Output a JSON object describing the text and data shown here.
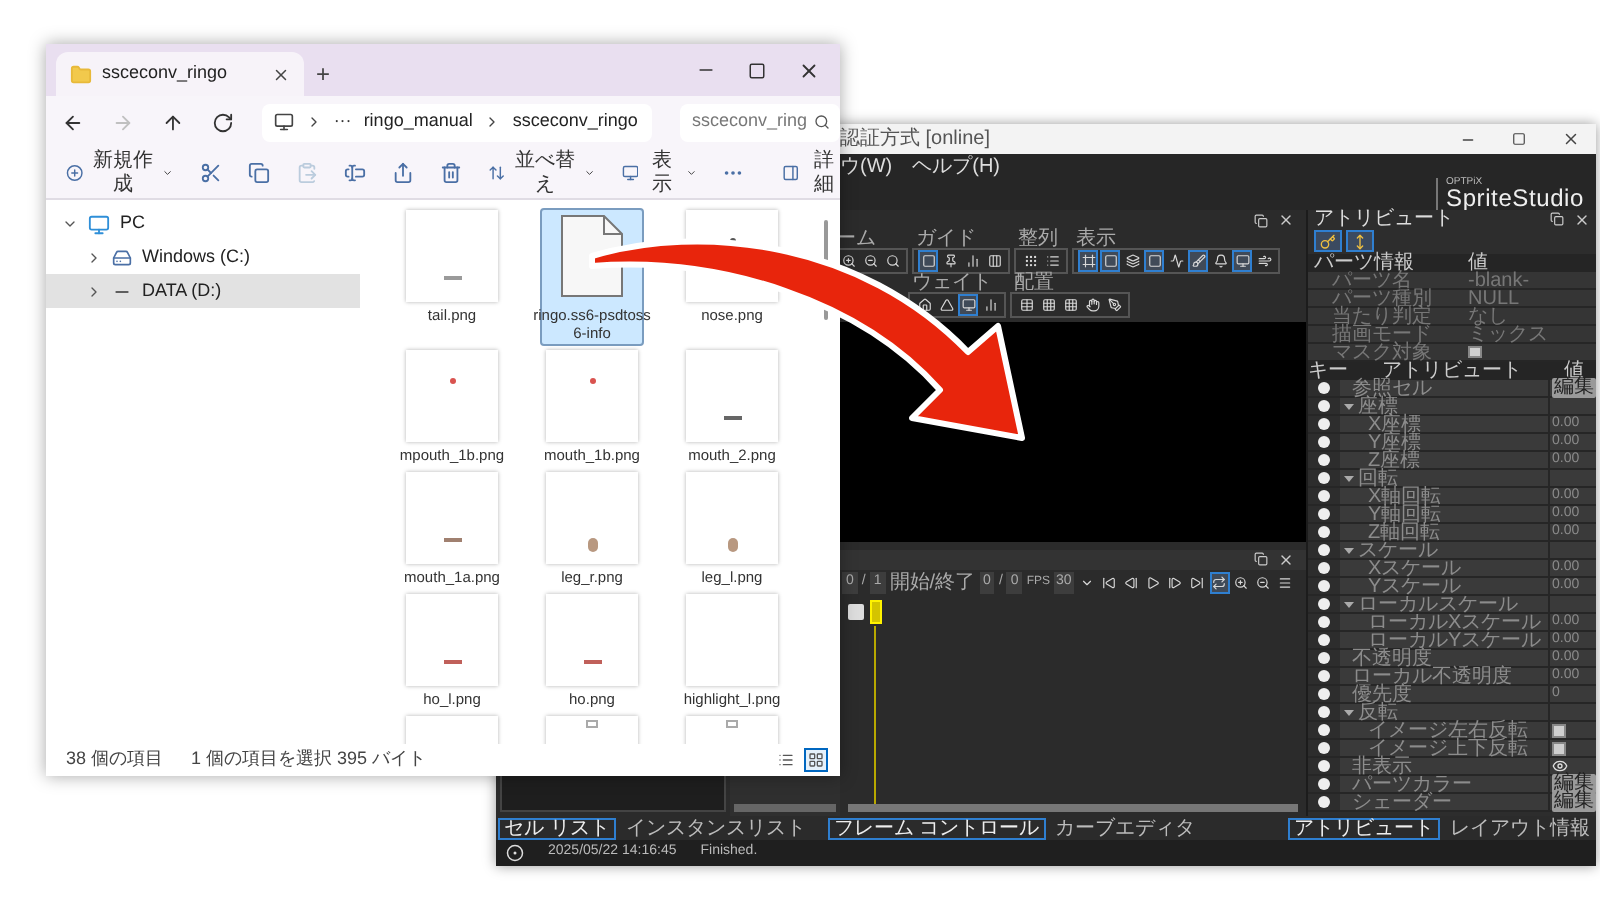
{
  "explorer": {
    "tab": {
      "title": "ssceconv_ringo",
      "add": "+"
    },
    "nav": [
      {
        "kind": "back",
        "disabled": false
      },
      {
        "kind": "forward",
        "disabled": true
      },
      {
        "kind": "up",
        "disabled": false
      },
      {
        "kind": "refresh",
        "disabled": false
      }
    ],
    "address": {
      "ellipsis": "···",
      "path": [
        "ringo_manual",
        "ssceconv_ringo"
      ]
    },
    "search": {
      "placeholder": "ssceconv_ring"
    },
    "toolbar": [
      {
        "kind": "new",
        "label": "新規作成",
        "disabled": false
      },
      {
        "kind": "cut",
        "disabled": false
      },
      {
        "kind": "copy",
        "disabled": false
      },
      {
        "kind": "paste",
        "disabled": true
      },
      {
        "kind": "rename",
        "disabled": false
      },
      {
        "kind": "share",
        "disabled": false
      },
      {
        "kind": "delete",
        "disabled": false
      },
      {
        "kind": "sort",
        "label": "並べ替え",
        "disabled": false
      },
      {
        "kind": "view",
        "label": "表示",
        "disabled": false
      },
      {
        "kind": "more",
        "disabled": false
      },
      {
        "kind": "details",
        "label": "詳細",
        "disabled": false
      }
    ],
    "sidebar": {
      "items": [
        {
          "kind": "pc",
          "label": "PC",
          "expanded": true,
          "selected": false,
          "children": [
            {
              "kind": "system",
              "label": "Windows (C:)",
              "expanded": false,
              "selected": false
            },
            {
              "kind": "drive",
              "label": "DATA (D:)",
              "expanded": false,
              "selected": true
            }
          ]
        }
      ]
    },
    "files": [
      {
        "name": "tail.png",
        "kind": "dash",
        "color": "#9a9a9a",
        "selected": false
      },
      {
        "name": "ringo.ss6-psdtoss6-info",
        "kind": "doc",
        "color": "#f7f7f7",
        "selected": true
      },
      {
        "name": "nose.png",
        "kind": "dot",
        "color": "#555555",
        "selected": false
      },
      {
        "name": "mpouth_1b.png",
        "kind": "dot",
        "color": "#d9534f",
        "selected": false
      },
      {
        "name": "mouth_1b.png",
        "kind": "dot",
        "color": "#d9534f",
        "selected": false
      },
      {
        "name": "mouth_2.png",
        "kind": "dash",
        "color": "#666666",
        "selected": false
      },
      {
        "name": "mouth_1a.png",
        "kind": "dash",
        "color": "#a08070",
        "selected": false
      },
      {
        "name": "leg_r.png",
        "kind": "oval",
        "color": "#b89880",
        "selected": false
      },
      {
        "name": "leg_l.png",
        "kind": "oval",
        "color": "#b89880",
        "selected": false
      },
      {
        "name": "ho_l.png",
        "kind": "dash",
        "color": "#c0605a",
        "selected": false
      },
      {
        "name": "ho.png",
        "kind": "dash",
        "color": "#c0605a",
        "selected": false
      },
      {
        "name": "highlight_l.png",
        "kind": "none",
        "selected": false
      },
      {
        "kind": "none",
        "selected": false
      },
      {
        "kind": "chip",
        "color": "#aaaaaa",
        "selected": false
      },
      {
        "kind": "chip",
        "color": "#aaaaaa",
        "selected": false
      }
    ],
    "status": [
      "38 個の項目",
      "1 個の項目を選択 395 バイト"
    ],
    "views": [
      {
        "kind": "details",
        "selected": false
      },
      {
        "kind": "tiles",
        "selected": true
      }
    ]
  },
  "sprite_studio": {
    "title": "認証方式 [online]",
    "menu": [
      "ウ(W)",
      "ヘルプ(H)"
    ],
    "logo": {
      "maker": "OPTPiX",
      "name": "SpriteStudio"
    },
    "toolbar_rows": [
      [
        {
          "label": "ーム",
          "tools": [
            {
              "kind": "zoomin",
              "selected": false
            },
            {
              "kind": "zoomout",
              "selected": false
            },
            {
              "kind": "zoomfit",
              "selected": false
            }
          ]
        },
        {
          "label": "ガイド",
          "tools": [
            {
              "kind": "square",
              "selected": true
            },
            {
              "kind": "pin",
              "selected": false
            },
            {
              "kind": "chart",
              "selected": false
            },
            {
              "kind": "columns",
              "selected": false
            }
          ]
        },
        {
          "label": "整列",
          "tools": [
            {
              "kind": "grip",
              "selected": false
            },
            {
              "kind": "list",
              "selected": false
            }
          ]
        },
        {
          "label": "表示",
          "tools": [
            {
              "kind": "frame",
              "selected": true
            },
            {
              "kind": "square",
              "selected": true
            },
            {
              "kind": "layers",
              "selected": false
            },
            {
              "kind": "square",
              "selected": true
            },
            {
              "kind": "activity",
              "selected": false
            },
            {
              "kind": "brush",
              "selected": true
            },
            {
              "kind": "bell",
              "selected": false
            },
            {
              "kind": "monitor",
              "selected": true
            },
            {
              "kind": "wind",
              "selected": false
            }
          ]
        }
      ],
      [
        {
          "label": "ウェイト",
          "tools": [
            {
              "kind": "house",
              "selected": false
            },
            {
              "kind": "triangle",
              "selected": false
            },
            {
              "kind": "monitor",
              "selected": true
            },
            {
              "kind": "chart",
              "selected": false
            }
          ]
        },
        {
          "label": "配置",
          "tools": [
            {
              "kind": "table",
              "selected": false
            },
            {
              "kind": "grid",
              "selected": false
            },
            {
              "kind": "grid",
              "selected": false
            },
            {
              "kind": "hand",
              "selected": false
            },
            {
              "kind": "pen",
              "selected": false
            }
          ]
        }
      ]
    ],
    "timeline": {
      "frame": "0",
      "sep1": "/",
      "total": "1",
      "range_label": "開始/終了",
      "start": "0",
      "sep2": "/",
      "end": "0",
      "fps_label": "FPS",
      "fps": "30",
      "buttons": [
        {
          "kind": "dropdown",
          "selected": false
        },
        {
          "kind": "first",
          "selected": false
        },
        {
          "kind": "prev",
          "selected": false
        },
        {
          "kind": "play",
          "selected": false
        },
        {
          "kind": "next",
          "selected": false
        },
        {
          "kind": "last",
          "selected": false
        },
        {
          "kind": "loop",
          "selected": true
        },
        {
          "kind": "zoomin",
          "selected": false
        },
        {
          "kind": "zoomout",
          "selected": false
        },
        {
          "kind": "menu",
          "selected": false
        }
      ]
    },
    "attribute_panel": {
      "title": "アトリビュート",
      "tools": [
        {
          "kind": "key",
          "selected": true
        },
        {
          "kind": "fit",
          "selected": true
        }
      ],
      "parts_columns": [
        "パーツ情報",
        "値"
      ],
      "parts": [
        {
          "kind": "value",
          "label": "パーツ名",
          "value": "-blank-"
        },
        {
          "kind": "value",
          "label": "パーツ種別",
          "value": "NULL"
        },
        {
          "kind": "value",
          "label": "当たり判定",
          "value": "なし"
        },
        {
          "kind": "value",
          "label": "描画モード",
          "value": "ミックス"
        },
        {
          "kind": "check",
          "label": "マスク対象",
          "checked": false
        }
      ],
      "columns": [
        "キー",
        "アトリビュート",
        "値"
      ],
      "rows": [
        {
          "kind": "button",
          "label": "参照セル",
          "button": "編集"
        },
        {
          "kind": "group",
          "label": "座標",
          "expanded": true,
          "children": [
            {
              "kind": "value",
              "label": "X座標",
              "value": "0.00"
            },
            {
              "kind": "value",
              "label": "Y座標",
              "value": "0.00"
            },
            {
              "kind": "value",
              "label": "Z座標",
              "value": "0.00"
            }
          ]
        },
        {
          "kind": "group",
          "label": "回転",
          "expanded": true,
          "children": [
            {
              "kind": "value",
              "label": "X軸回転",
              "value": "0.00"
            },
            {
              "kind": "value",
              "label": "Y軸回転",
              "value": "0.00"
            },
            {
              "kind": "value",
              "label": "Z軸回転",
              "value": "0.00"
            }
          ]
        },
        {
          "kind": "group",
          "label": "スケール",
          "expanded": true,
          "children": [
            {
              "kind": "value",
              "label": "Xスケール",
              "value": "0.00"
            },
            {
              "kind": "value",
              "label": "Yスケール",
              "value": "0.00"
            }
          ]
        },
        {
          "kind": "group",
          "label": "ローカルスケール",
          "expanded": true,
          "children": [
            {
              "kind": "value",
              "label": "ローカルXスケール",
              "value": "0.00"
            },
            {
              "kind": "value",
              "label": "ローカルYスケール",
              "value": "0.00"
            }
          ]
        },
        {
          "kind": "value",
          "label": "不透明度",
          "value": "0.00"
        },
        {
          "kind": "value",
          "label": "ローカル不透明度",
          "value": "0.00"
        },
        {
          "kind": "value",
          "label": "優先度",
          "value": "0"
        },
        {
          "kind": "group",
          "label": "反転",
          "expanded": true,
          "children": [
            {
              "kind": "check",
              "label": "イメージ左右反転",
              "checked": false
            },
            {
              "kind": "check",
              "label": "イメージ上下反転",
              "checked": false
            }
          ]
        },
        {
          "kind": "eye",
          "label": "非表示"
        },
        {
          "kind": "button",
          "label": "パーツカラー",
          "button": "編集"
        },
        {
          "kind": "button",
          "label": "シェーダー",
          "button": "編集"
        }
      ]
    },
    "tabs": [
      [
        {
          "label": "セル リスト",
          "selected": true
        },
        {
          "label": "インスタンスリスト",
          "selected": false
        }
      ],
      [
        {
          "label": "フレーム コントロール",
          "selected": true
        },
        {
          "label": "カーブエディタ",
          "selected": false
        }
      ],
      [
        {
          "label": "アトリビュート",
          "selected": true
        },
        {
          "label": "レイアウト情報",
          "selected": false
        }
      ]
    ],
    "status": {
      "time": "2025/05/22 14:16:45",
      "message": "Finished."
    }
  }
}
